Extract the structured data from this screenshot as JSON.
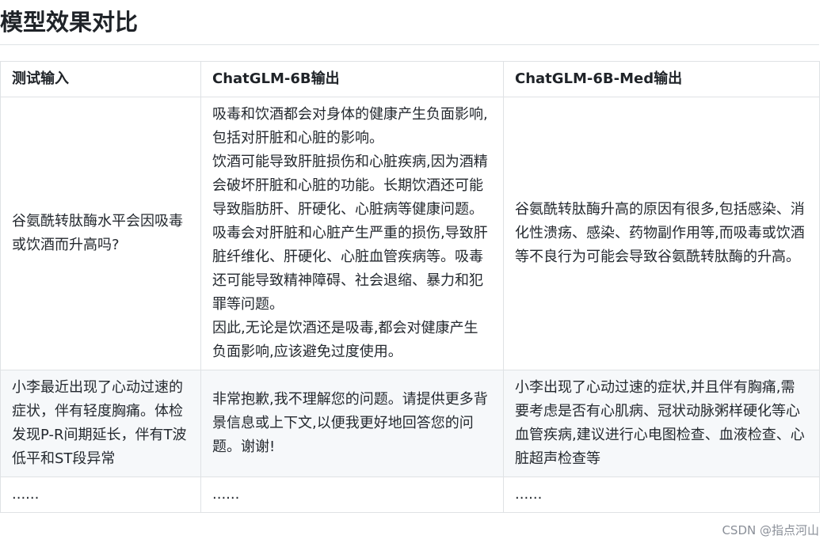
{
  "page": {
    "title": "模型效果对比"
  },
  "table": {
    "headers": [
      "测试输入",
      "ChatGLM-6B输出",
      "ChatGLM-6B-Med输出"
    ],
    "rows": [
      {
        "input": "谷氨酰转肽酶水平会因吸毒或饮酒而升高吗?",
        "chatglm": [
          "吸毒和饮酒都会对身体的健康产生负面影响,包括对肝脏和心脏的影响。",
          "饮酒可能导致肝脏损伤和心脏疾病,因为酒精会破坏肝脏和心脏的功能。长期饮酒还可能导致脂肪肝、肝硬化、心脏病等健康问题。",
          "吸毒会对肝脏和心脏产生严重的损伤,导致肝脏纤维化、肝硬化、心脏血管疾病等。吸毒还可能导致精神障碍、社会退缩、暴力和犯罪等问题。",
          "因此,无论是饮酒还是吸毒,都会对健康产生负面影响,应该避免过度使用。"
        ],
        "chatglm_med": "谷氨酰转肽酶升高的原因有很多,包括感染、消化性溃疡、感染、药物副作用等,而吸毒或饮酒等不良行为可能会导致谷氨酰转肽酶的升高。"
      },
      {
        "input": "小李最近出现了心动过速的症状，伴有轻度胸痛。体检发现P-R间期延长，伴有T波低平和ST段异常",
        "chatglm": "非常抱歉,我不理解您的问题。请提供更多背景信息或上下文,以便我更好地回答您的问题。谢谢!",
        "chatglm_med": "小李出现了心动过速的症状,并且伴有胸痛,需要考虑是否有心肌病、冠状动脉粥样硬化等心血管疾病,建议进行心电图检查、血液检查、心脏超声检查等"
      },
      {
        "input": "......",
        "chatglm": "......",
        "chatglm_med": "......"
      }
    ]
  },
  "watermark": "CSDN @指点河山"
}
